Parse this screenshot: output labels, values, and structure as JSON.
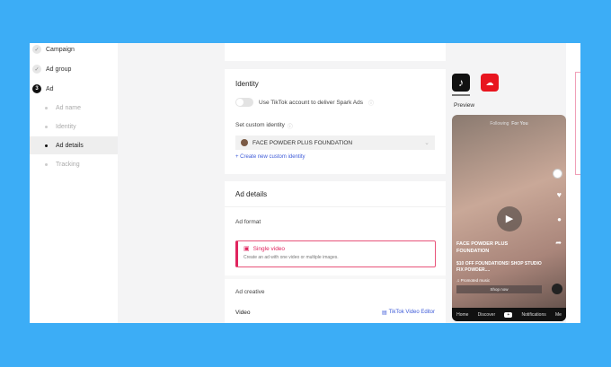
{
  "sidebar": {
    "items": [
      {
        "label": "Campaign",
        "state": "done"
      },
      {
        "label": "Ad group",
        "state": "done"
      },
      {
        "label": "Ad",
        "number": "3"
      },
      {
        "label": "Ad name"
      },
      {
        "label": "Identity"
      },
      {
        "label": "Ad details",
        "active": true
      },
      {
        "label": "Tracking"
      }
    ]
  },
  "identity": {
    "title": "Identity",
    "spark_label": "Use TikTok account to deliver Spark Ads",
    "custom_label": "Set custom identity",
    "selected": "FACE  POWDER PLUS FOUNDATION",
    "create_link": "+ Create new custom identity"
  },
  "details": {
    "title": "Ad details",
    "format_label": "Ad format",
    "format_name": "Single video",
    "format_desc": "Create an ad with one video or multiple images.",
    "creative_label": "Ad creative",
    "video_label": "Video",
    "editor_link": "TikTok Video Editor"
  },
  "preview": {
    "label": "Preview",
    "tabs": [
      "Following",
      "For You"
    ],
    "account": "FACE POWDER PLUS FOUNDATION",
    "caption": "$10 OFF FOUNDATIONS! SHOP STUDIO FIX POWDER....",
    "sound": "Promoted music",
    "cta": "Shop now",
    "nav": [
      "Home",
      "Discover",
      "+",
      "Notifications",
      "Me"
    ]
  },
  "colors": {
    "background": "#3cadf6",
    "accent": "#e0245e",
    "link": "#3e5bd8"
  }
}
